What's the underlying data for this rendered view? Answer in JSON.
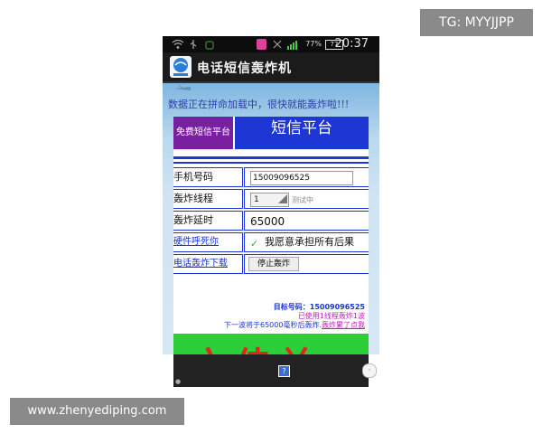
{
  "watermarks": {
    "top": "TG: MYYJJPP",
    "bottom": "www.zhenyediping.com"
  },
  "statusbar": {
    "battery_percent": "77%",
    "battery_level": "77",
    "time": "20:37"
  },
  "app": {
    "title": "电话短信轰炸机"
  },
  "web": {
    "loading_text": "数据正在拼命加载中，很快就能轰炸啦!!!",
    "tabs": {
      "left": "免费短信平台",
      "right": "短信平台"
    },
    "form": {
      "phone_label": "手机号码",
      "phone_value": "15009096525",
      "threads_label": "轰炸线程",
      "threads_value": "1",
      "testing": "测试中",
      "delay_label": "轰炸延时",
      "delay_value": "65000",
      "hardware_label": "硬件呼死你",
      "agree_label": "我愿意承担所有后果",
      "download_label": "电话轰炸下载",
      "stop_button": "停止轰炸"
    },
    "info": {
      "target": "目标号码：15009096525",
      "used": "已使用1线程轰炸1波",
      "next_prefix": "下一波将于65000毫秒后轰炸.",
      "next_link": "轰炸累了点我"
    },
    "banner_text": "六佳兰"
  },
  "colors": {
    "purple_tab": "#7a1fa0",
    "blue_tab": "#1d36d4",
    "green_banner": "#2bcf3a",
    "red_text": "#e2261c"
  }
}
